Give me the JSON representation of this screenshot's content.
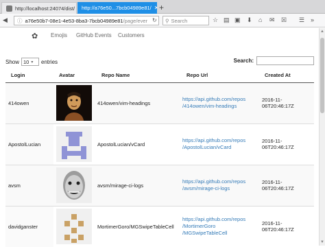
{
  "browser": {
    "tabs": [
      {
        "title": "http://localhost:24074/dist/",
        "active": false
      },
      {
        "title": "http://a76e50...7bcb04989e81/",
        "active": true
      }
    ],
    "new_tab_label": "+",
    "url_host": "a76e50b7-08e1-4e53-8ba3-7bcb04989e81",
    "url_path": "/page/ever",
    "search_placeholder": "Search",
    "accent_color": "#1f8fe6"
  },
  "app_nav": {
    "links": [
      "Emojis",
      "GitHub Events",
      "Customers"
    ]
  },
  "table_controls": {
    "show_label": "Show",
    "page_size": "10",
    "entries_label": "entries",
    "search_label": "Search:",
    "search_value": ""
  },
  "table": {
    "headers": [
      "Login",
      "Avatar",
      "Repo Name",
      "Repo Url",
      "Created At"
    ],
    "rows": [
      {
        "login": "414owen",
        "avatar": "photo-dark-figure",
        "repo_name": "414owen/vim-headings",
        "url_line1": "https://api.github.com/repos",
        "url_line2": "/414owen/vim-headings",
        "created_at": "2016-11-06T20:46:17Z"
      },
      {
        "login": "ApostolLucian",
        "avatar": "identicon-purple",
        "repo_name": "ApostolLucian/vCard",
        "url_line1": "https://api.github.com/repos",
        "url_line2": "/ApostolLucian/vCard",
        "created_at": "2016-11-06T20:46:17Z"
      },
      {
        "login": "avsm",
        "avatar": "photo-face",
        "repo_name": "avsm/mirage-ci-logs",
        "url_line1": "https://api.github.com/repos",
        "url_line2": "/avsm/mirage-ci-logs",
        "created_at": "2016-11-06T20:46:17Z"
      },
      {
        "login": "davidganster",
        "avatar": "identicon-tan",
        "repo_name": "MortimerGoro/MGSwipeTableCell",
        "url_line1": "https://api.github.com/repos",
        "url_line2": "/MortimerGoro",
        "url_line3": "/MGSwipeTableCell",
        "created_at": "2016-11-06T20:46:17Z"
      }
    ]
  },
  "colors": {
    "link": "#337ab7",
    "identicon_purple": "#8f93d6",
    "identicon_tan": "#c9a165"
  }
}
